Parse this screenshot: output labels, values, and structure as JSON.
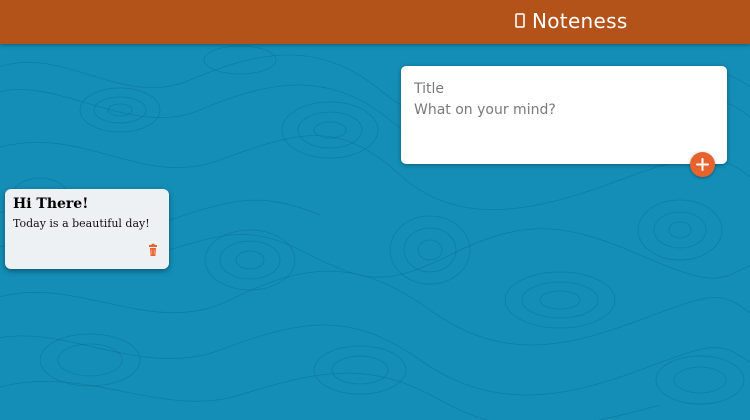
{
  "header": {
    "app_name": "Noteness",
    "icon": "note-icon",
    "background_color": "#b3531a"
  },
  "page": {
    "background_color": "#148eb7"
  },
  "create_form": {
    "title_placeholder": "Title",
    "content_placeholder": "What on your mind?",
    "add_icon": "plus-icon",
    "add_button_color": "#e7632d"
  },
  "notes": [
    {
      "title": "Hi There!",
      "content": "Today is a beautiful day!",
      "delete_icon": "trash-icon",
      "delete_color": "#e7632d"
    }
  ]
}
